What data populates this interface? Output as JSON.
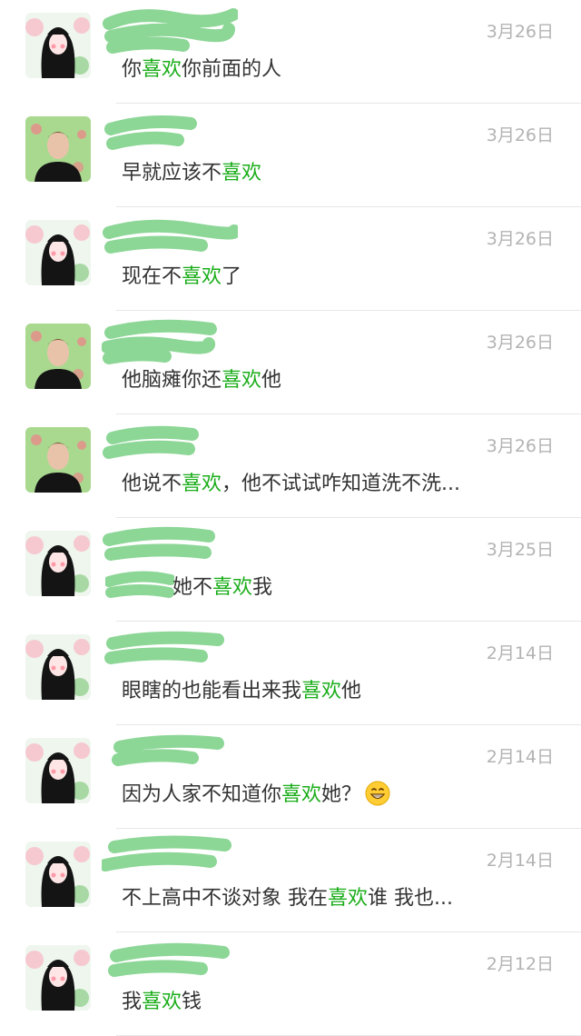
{
  "colors": {
    "highlight": "#1aad19",
    "date": "#b3b3b3",
    "text": "#333333",
    "scribble": "#7fd28b"
  },
  "messages": [
    {
      "avatar": "girl-avatar",
      "date": "3月26日",
      "parts": [
        "你",
        "喜欢",
        "你前面的人"
      ]
    },
    {
      "avatar": "boy-avatar",
      "date": "3月26日",
      "parts": [
        "早就应该不",
        "喜欢",
        ""
      ]
    },
    {
      "avatar": "girl-avatar",
      "date": "3月26日",
      "parts": [
        "现在不",
        "喜欢",
        "了"
      ]
    },
    {
      "avatar": "boy-avatar",
      "date": "3月26日",
      "parts": [
        "他脑瘫你还",
        "喜欢",
        "他"
      ]
    },
    {
      "avatar": "boy-avatar",
      "date": "3月26日",
      "parts": [
        "他说不",
        "喜欢",
        "，他不试试咋知道洗不洗..."
      ]
    },
    {
      "avatar": "girl-avatar",
      "date": "3月25日",
      "parts": [
        "她不",
        "喜欢",
        "我"
      ]
    },
    {
      "avatar": "girl-avatar",
      "date": "2月14日",
      "parts": [
        "眼瞎的也能看出来我",
        "喜欢",
        "他"
      ]
    },
    {
      "avatar": "girl-avatar",
      "date": "2月14日",
      "parts": [
        "因为人家不知道你",
        "喜欢",
        "她？"
      ]
    },
    {
      "avatar": "girl-avatar",
      "date": "2月14日",
      "parts": [
        "不上高中不谈对象 我在",
        "喜欢",
        "谁 我也..."
      ]
    },
    {
      "avatar": "girl-avatar",
      "date": "2月12日",
      "parts": [
        "我",
        "喜欢",
        "钱"
      ]
    }
  ]
}
